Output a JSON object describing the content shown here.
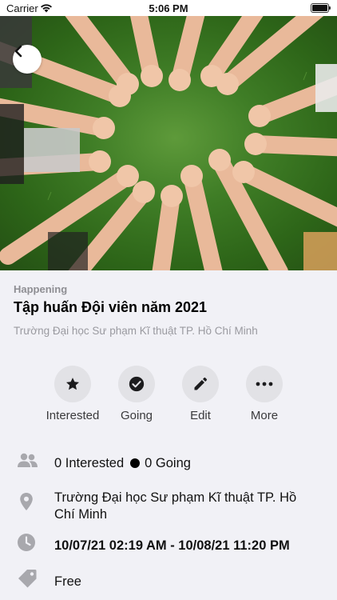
{
  "status_bar": {
    "carrier": "Carrier",
    "time": "5:06 PM"
  },
  "hero": {
    "image_description_icon": "hands-in-circle-photo",
    "back_icon": "chevron-left-icon"
  },
  "event": {
    "status": "Happening",
    "title": "Tập huấn Đội viên năm 2021",
    "subtitle_location": "Trường Đại học Sư phạm  Kĩ thuật TP. Hồ Chí Minh"
  },
  "actions": [
    {
      "label": "Interested",
      "icon": "star-icon"
    },
    {
      "label": "Going",
      "icon": "check-circle-icon"
    },
    {
      "label": "Edit",
      "icon": "pencil-icon"
    },
    {
      "label": "More",
      "icon": "ellipsis-icon"
    }
  ],
  "details": {
    "interested_count": "0 Interested",
    "going_count": "0 Going",
    "location": "Trường Đại học Sư phạm  Kĩ thuật TP. Hồ Chí Minh",
    "datetime": "10/07/21 02:19 AM - 10/08/21 11:20 PM",
    "price": "Free"
  },
  "colors": {
    "background": "#f1f1f6",
    "icon_gray": "#a8a8ad",
    "action_circle": "#e2e2e6",
    "muted_text": "#8e8e93"
  }
}
